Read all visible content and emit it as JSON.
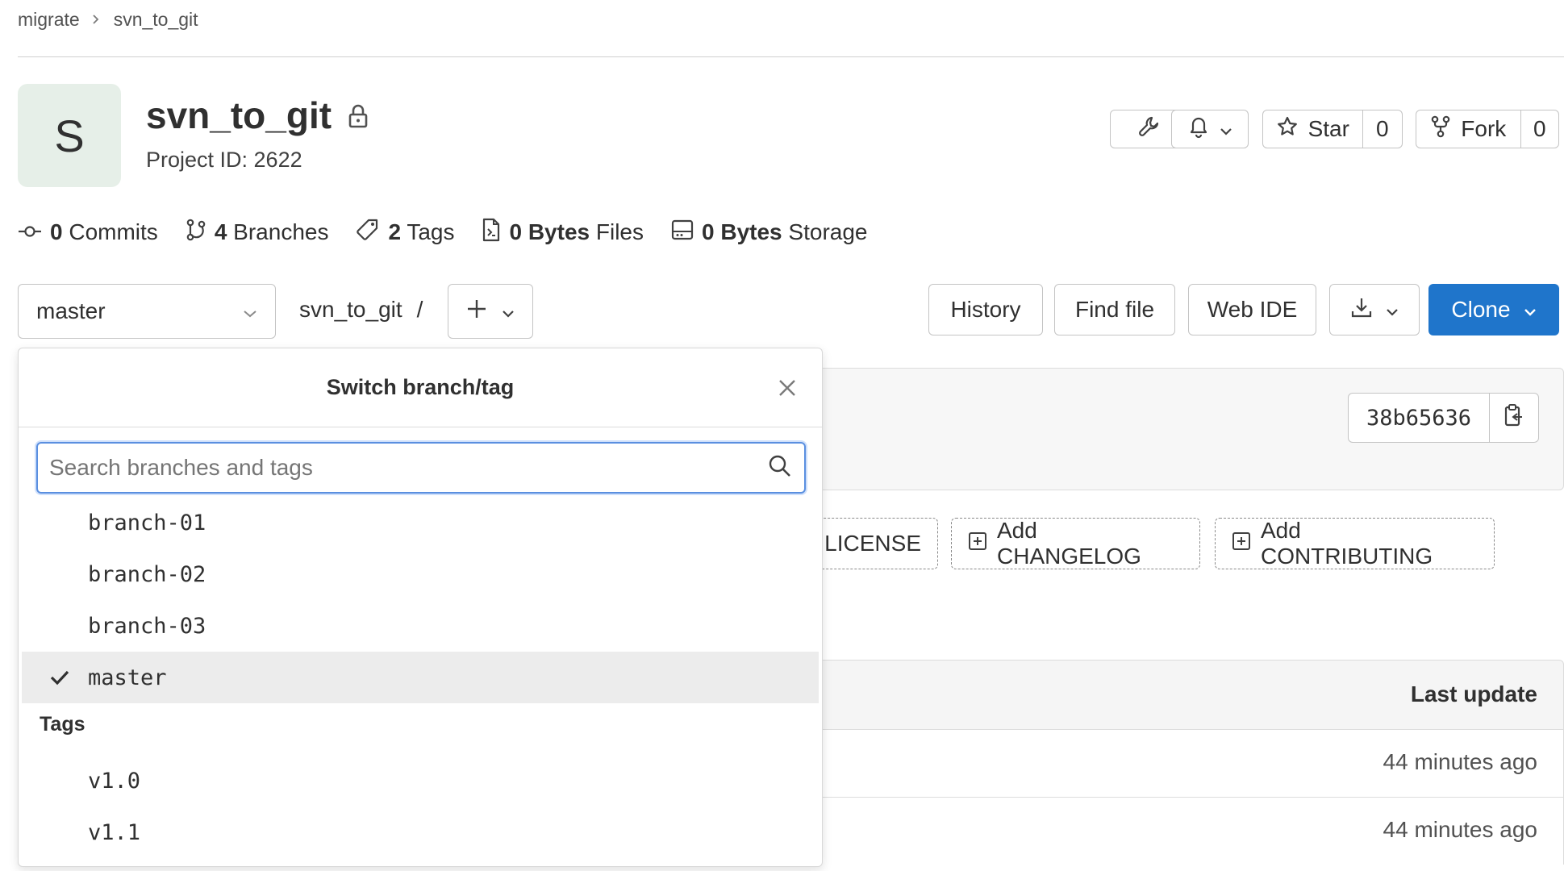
{
  "breadcrumb": {
    "group": "migrate",
    "project": "svn_to_git"
  },
  "project": {
    "avatar_letter": "S",
    "name": "svn_to_git",
    "id_text": "Project ID: 2622"
  },
  "header_actions": {
    "star_label": "Star",
    "star_count": "0",
    "fork_label": "Fork",
    "fork_count": "0"
  },
  "stats": [
    {
      "count": "0",
      "label": "Commits",
      "icon": "commit-icon"
    },
    {
      "count": "4",
      "label": "Branches",
      "icon": "branch-icon"
    },
    {
      "count": "2",
      "label": "Tags",
      "icon": "tag-icon"
    },
    {
      "count": "0 Bytes",
      "label": "Files",
      "icon": "file-icon"
    },
    {
      "count": "0 Bytes",
      "label": "Storage",
      "icon": "storage-icon"
    }
  ],
  "toolbar": {
    "branch": "master",
    "path": "svn_to_git",
    "path_sep": "/",
    "history": "History",
    "find_file": "Find file",
    "web_ide": "Web IDE",
    "clone": "Clone"
  },
  "commit": {
    "sha": "38b65636"
  },
  "suggestions": {
    "license": "LICENSE",
    "changelog": "Add CHANGELOG",
    "contributing": "Add CONTRIBUTING"
  },
  "table": {
    "last_update_header": "Last update",
    "rows": [
      "44 minutes ago",
      "44 minutes ago"
    ]
  },
  "dropdown": {
    "title": "Switch branch/tag",
    "search_placeholder": "Search branches and tags",
    "branches": [
      "branch-01",
      "branch-02",
      "branch-03",
      "master"
    ],
    "selected_branch": "master",
    "tags_header": "Tags",
    "tags": [
      "v1.0",
      "v1.1"
    ]
  },
  "colors": {
    "primary": "#1f75cb",
    "avatar_bg": "#e6efe8",
    "selected_row": "#ececec"
  }
}
